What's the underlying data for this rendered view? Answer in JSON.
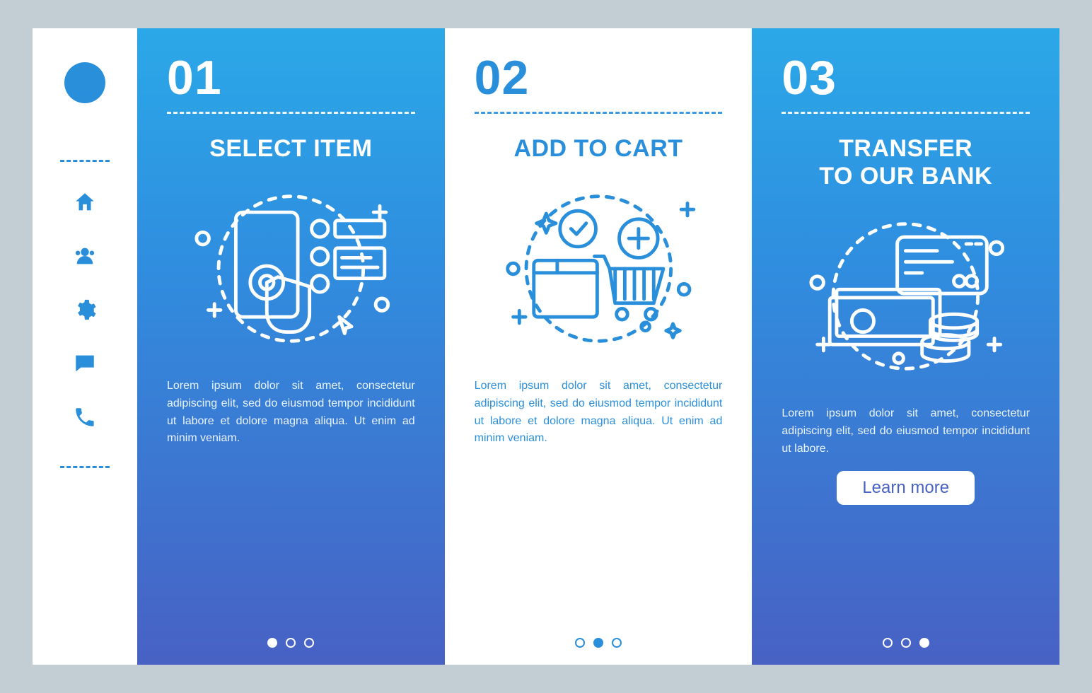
{
  "sidebar": {
    "icons": [
      "home-icon",
      "users-icon",
      "gear-icon",
      "chat-icon",
      "phone-icon"
    ]
  },
  "steps": [
    {
      "num": "01",
      "title": "SELECT ITEM",
      "body": "Lorem ipsum dolor sit amet, consectetur adipiscing elit, sed do eiusmod tempor incididunt ut labore et dolore magna aliqua. Ut enim ad minim veniam.",
      "active_dot": 0
    },
    {
      "num": "02",
      "title": "ADD TO CART",
      "body": "Lorem ipsum dolor sit amet, consectetur adipiscing elit, sed do eiusmod tempor incididunt ut labore et dolore magna aliqua. Ut enim ad minim veniam.",
      "active_dot": 1
    },
    {
      "num": "03",
      "title": "TRANSFER\nTO OUR BANK",
      "body": "Lorem ipsum dolor sit amet, consectetur adipiscing elit, sed do eiusmod tempor incididunt ut labore.",
      "active_dot": 2
    }
  ],
  "button": {
    "label": "Learn more"
  },
  "colors": {
    "accent": "#2a8fdb",
    "gradient_top": "#2ba8e8",
    "gradient_bottom": "#4861c4",
    "page_bg": "#c2ced3"
  }
}
